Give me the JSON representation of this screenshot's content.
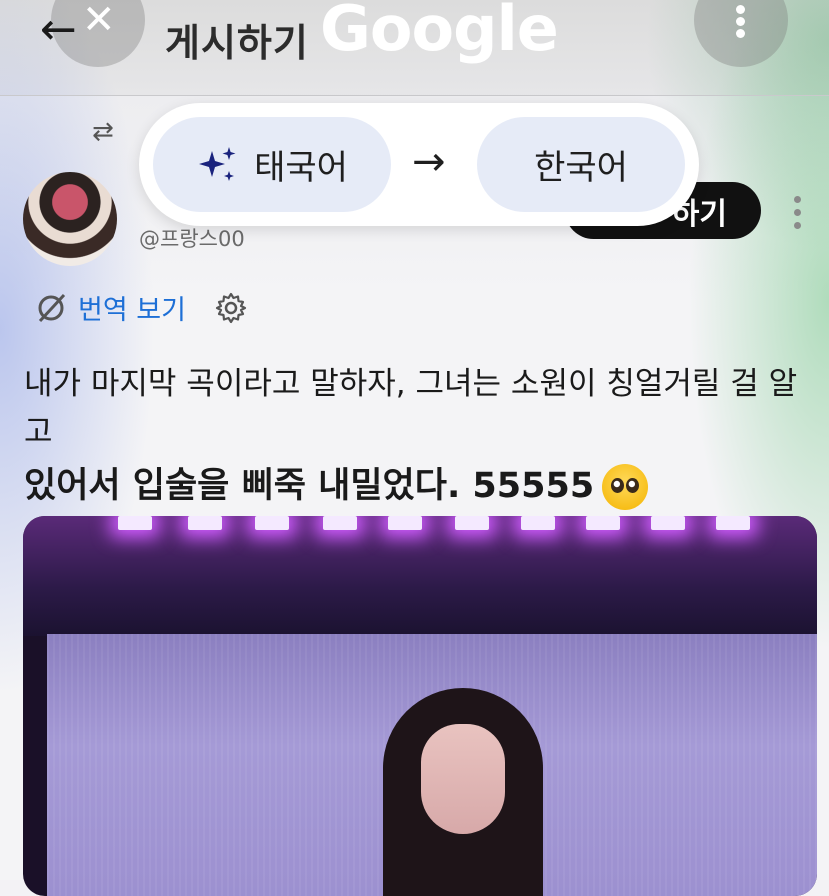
{
  "header": {
    "back_icon": "arrow-left-icon",
    "close_icon": "close-icon",
    "title": "게시하기",
    "brand": "Google",
    "more_icon": "more-vert-icon"
  },
  "translate_bar": {
    "source_language": "태국어",
    "target_language": "한국어",
    "sparkle_icon": "sparkle-icon",
    "arrow_icon": "arrow-right-icon"
  },
  "post": {
    "handle": "@프랑스00",
    "follow_label": "하기",
    "translate_link": "번역 보기",
    "text_line1": "내가 마지막 곡이라고 말하자, 그녀는 소원이 칭얼거릴 걸 알고",
    "text_line2": "있어서 입술을 삐죽 내밀었다. 55555"
  },
  "colors": {
    "link": "#1d6fd6",
    "chip_bg": "#e6ebf7",
    "follow_bg": "#111111"
  }
}
